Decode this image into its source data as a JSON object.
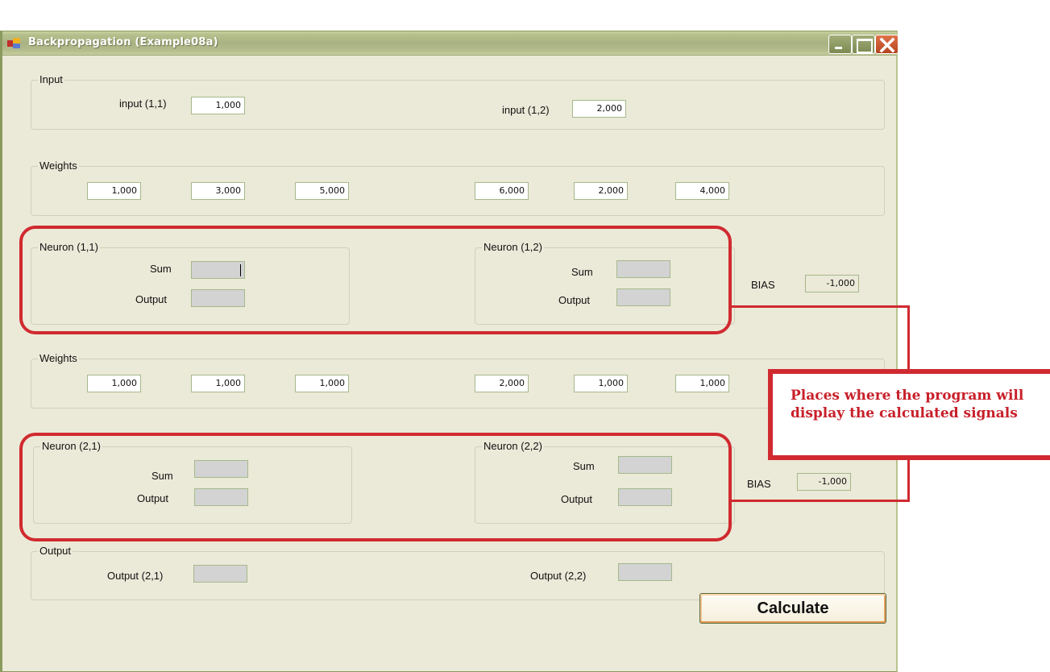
{
  "window": {
    "title": "Backpropagation (Example08a)",
    "controls": {
      "minimize": "minimize",
      "maximize": "maximize",
      "close": "close"
    }
  },
  "input_group": {
    "label": "Input",
    "fields": [
      {
        "label": "input (1,1)",
        "value": "1,000"
      },
      {
        "label": "input (1,2)",
        "value": "2,000"
      }
    ]
  },
  "weights1": {
    "label": "Weights",
    "values": [
      "1,000",
      "3,000",
      "5,000",
      "6,000",
      "2,000",
      "4,000"
    ]
  },
  "layer1": {
    "neurons": [
      {
        "label": "Neuron (1,1)",
        "sum_label": "Sum",
        "output_label": "Output",
        "sum": "",
        "output": ""
      },
      {
        "label": "Neuron (1,2)",
        "sum_label": "Sum",
        "output_label": "Output",
        "sum": "",
        "output": ""
      }
    ],
    "bias_label": "BIAS",
    "bias_value": "-1,000"
  },
  "weights2": {
    "label": "Weights",
    "values": [
      "1,000",
      "1,000",
      "1,000",
      "2,000",
      "1,000",
      "1,000"
    ]
  },
  "layer2": {
    "neurons": [
      {
        "label": "Neuron (2,1)",
        "sum_label": "Sum",
        "output_label": "Output",
        "sum": "",
        "output": ""
      },
      {
        "label": "Neuron (2,2)",
        "sum_label": "Sum",
        "output_label": "Output",
        "sum": "",
        "output": ""
      }
    ],
    "bias_label": "BIAS",
    "bias_value": "-1,000"
  },
  "output_group": {
    "label": "Output",
    "fields": [
      {
        "label": "Output (2,1)",
        "value": ""
      },
      {
        "label": "Output (2,2)",
        "value": ""
      }
    ]
  },
  "calculate_label": "Calculate",
  "annotation": {
    "text": "Places where the program will display the calculated signals",
    "color": "#d02a30"
  }
}
